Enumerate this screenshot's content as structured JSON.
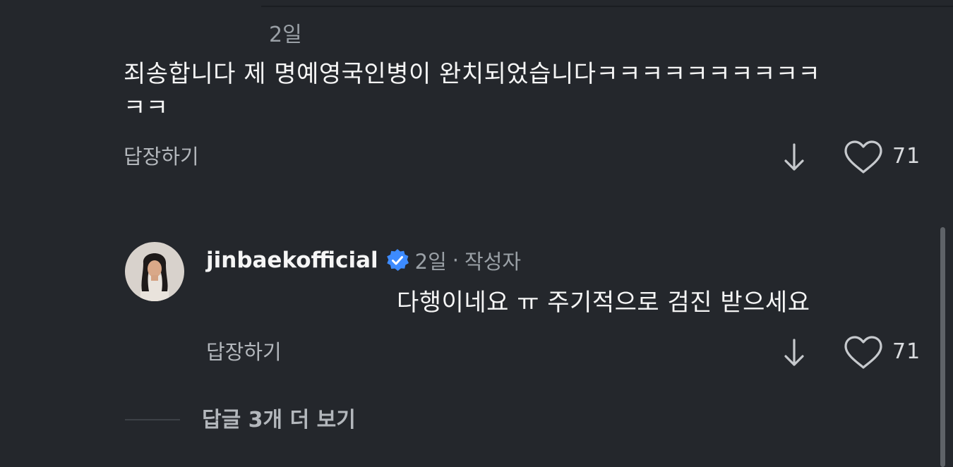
{
  "comment1": {
    "time": "2일",
    "text_line1": "죄송합니다 제 명예영국인병이 완치되었습니다ㅋㅋㅋㅋㅋㅋㅋㅋㅋㅋ",
    "text_line2": "ㅋㅋ",
    "reply_label": "답장하기",
    "like_count": "71"
  },
  "comment2": {
    "username": "jinbaekofficial",
    "verified": true,
    "time": "2일",
    "separator": "·",
    "author_tag": "작성자",
    "text": "다행이네요 ㅠ 주기적으로 검진 받으세요",
    "reply_label": "답장하기",
    "like_count": "71"
  },
  "more_replies": {
    "label": "답글 3개 더 보기"
  },
  "icons": {
    "downvote": "arrow-down-icon",
    "like": "heart-icon",
    "verified": "verified-badge-icon"
  },
  "colors": {
    "background": "#24272c",
    "text_primary": "#f5f5f5",
    "text_secondary": "#9aa0a6",
    "verified_blue": "#3d8bff"
  }
}
